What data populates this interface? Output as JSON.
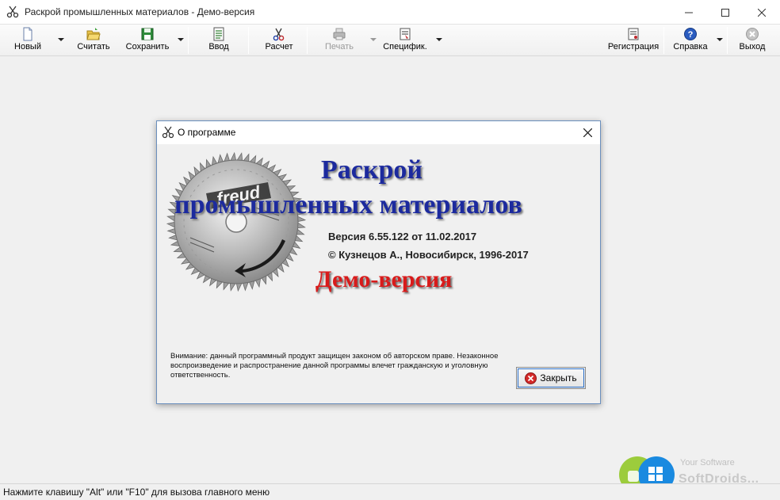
{
  "window": {
    "title": "Раскрой промышленных материалов - Демо-версия",
    "icon": "scissors-icon"
  },
  "toolbar": {
    "new_label": "Новый",
    "open_label": "Считать",
    "save_label": "Сохранить",
    "input_label": "Ввод",
    "calc_label": "Расчет",
    "print_label": "Печать",
    "spec_label": "Специфик.",
    "register_label": "Регистрация",
    "help_label": "Справка",
    "exit_label": "Выход"
  },
  "dialog": {
    "title": "О программе",
    "heading_line1": "Раскрой",
    "heading_line2": "промышленных материалов",
    "version": "Версия 6.55.122 от 11.02.2017",
    "copyright": "© Кузнецов А., Новосибирск, 1996-2017",
    "demo": "Демо-версия",
    "notice": "Внимание: данный программный продукт защищен законом об авторском праве. Незаконное воспроизведение и распространение данной программы влечет гражданскую и уголовную ответственность.",
    "close_label": "Закрыть",
    "saw_logo_text": "freud"
  },
  "watermark": {
    "line1": "Your Software",
    "line2": "SoftDroids..."
  },
  "statusbar": {
    "text": "Нажмите клавишу \"Alt\" или \"F10\" для вызова главного меню"
  },
  "colors": {
    "heading": "#1c2a9e",
    "demo": "#d81b1b",
    "dialog_border": "#6a8fbd"
  }
}
